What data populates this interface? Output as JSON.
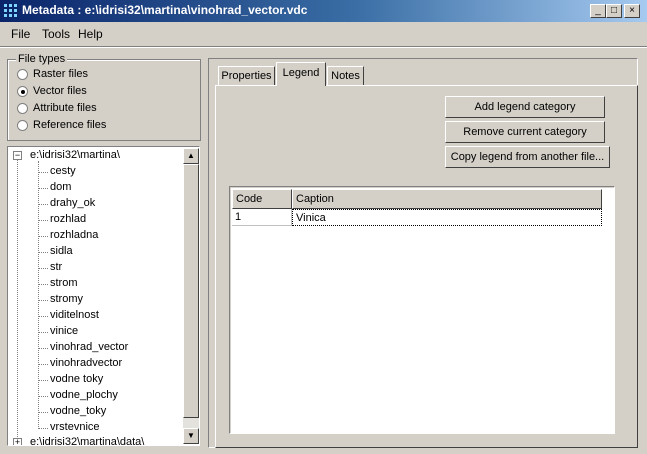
{
  "window": {
    "title": "Metadata : e:\\idrisi32\\martina\\vinohrad_vector.vdc",
    "minimize": "_",
    "maximize": "□",
    "close": "×"
  },
  "menu": [
    "File",
    "Tools",
    "Help"
  ],
  "file_types": {
    "legend": "File types",
    "options": [
      {
        "label": "Raster files",
        "selected": false
      },
      {
        "label": "Vector files",
        "selected": true
      },
      {
        "label": "Attribute files",
        "selected": false
      },
      {
        "label": "Reference files",
        "selected": false
      }
    ]
  },
  "tree": {
    "root": "e:\\idrisi32\\martina\\",
    "items": [
      "cesty",
      "dom",
      "drahy_ok",
      "rozhlad",
      "rozhladna",
      "sidla",
      "str",
      "strom",
      "stromy",
      "viditelnost",
      "vinice",
      "vinohrad_vector",
      "vinohradvector",
      "vodne toky",
      "vodne_plochy",
      "vodne_toky",
      "vrstevnice"
    ],
    "second_root": "e:\\idrisi32\\martina\\data\\",
    "collapse_glyph": "−",
    "expand_glyph": "+"
  },
  "tabs": [
    {
      "label": "Properties",
      "active": false
    },
    {
      "label": "Legend",
      "active": true
    },
    {
      "label": "Notes",
      "active": false
    }
  ],
  "buttons": {
    "add": "Add legend category",
    "remove": "Remove current category",
    "copy": "Copy legend from another file..."
  },
  "legend_table": {
    "columns": [
      "Code",
      "Caption"
    ],
    "rows": [
      {
        "code": "1",
        "caption": "Vinica"
      }
    ]
  },
  "icons": {
    "app": "grid-app-icon",
    "scroll_up": "▲",
    "scroll_down": "▼"
  }
}
